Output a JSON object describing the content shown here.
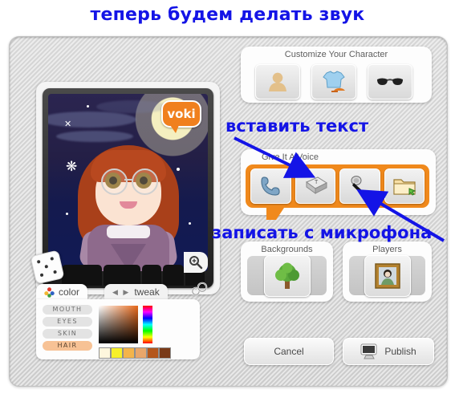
{
  "annotations": {
    "title": "теперь будем делать звук",
    "insert_text": "вставить текст",
    "record_mic": "записать с микрофона",
    "color": "#1414e6"
  },
  "brand": {
    "logo_text": "voki",
    "logo_color": "#f0801e"
  },
  "left": {
    "avatar": {
      "scene": "night-sky-with-moon",
      "character": "girl-red-hair-glasses"
    },
    "randomize_icon": "dice-icon",
    "zoom_icon": "magnifier-plus-icon",
    "settings_icon": "gears-icon",
    "tabs": [
      {
        "label": "color",
        "icon": "color-wheel-icon",
        "selected": true
      },
      {
        "label": "tweak",
        "icon": "arrows-icon",
        "selected": false
      }
    ],
    "features": [
      {
        "label": "MOUTH",
        "selected": false
      },
      {
        "label": "EYES",
        "selected": false
      },
      {
        "label": "SKIN",
        "selected": false
      },
      {
        "label": "HAIR",
        "selected": true
      }
    ],
    "swatches": [
      "#fdf6dd",
      "#f7f029",
      "#f4b44a",
      "#e9a66a",
      "#b4561b",
      "#7a3a18"
    ],
    "selected_hue": "#e8691a"
  },
  "groups": {
    "customize": {
      "title": "Customize Your Character",
      "buttons": [
        {
          "name": "head-icon",
          "label": "Head"
        },
        {
          "name": "clothing-icon",
          "label": "Clothing"
        },
        {
          "name": "sunglasses-icon",
          "label": "Accessories"
        }
      ]
    },
    "voice": {
      "title": "Give It A Voice",
      "highlight_color": "#f0891c",
      "buttons": [
        {
          "name": "phone-icon",
          "label": "Phone"
        },
        {
          "name": "keyboard-key-icon",
          "label": "Text To Speech"
        },
        {
          "name": "microphone-icon",
          "label": "Record With Mic"
        },
        {
          "name": "folder-upload-icon",
          "label": "Upload File"
        }
      ]
    },
    "backgrounds": {
      "title": "Backgrounds",
      "icon": "tree-icon"
    },
    "players": {
      "title": "Players",
      "icon": "framed-portrait-icon"
    }
  },
  "actions": {
    "cancel": "Cancel",
    "publish": "Publish",
    "publish_icon": "monitor-icon"
  }
}
